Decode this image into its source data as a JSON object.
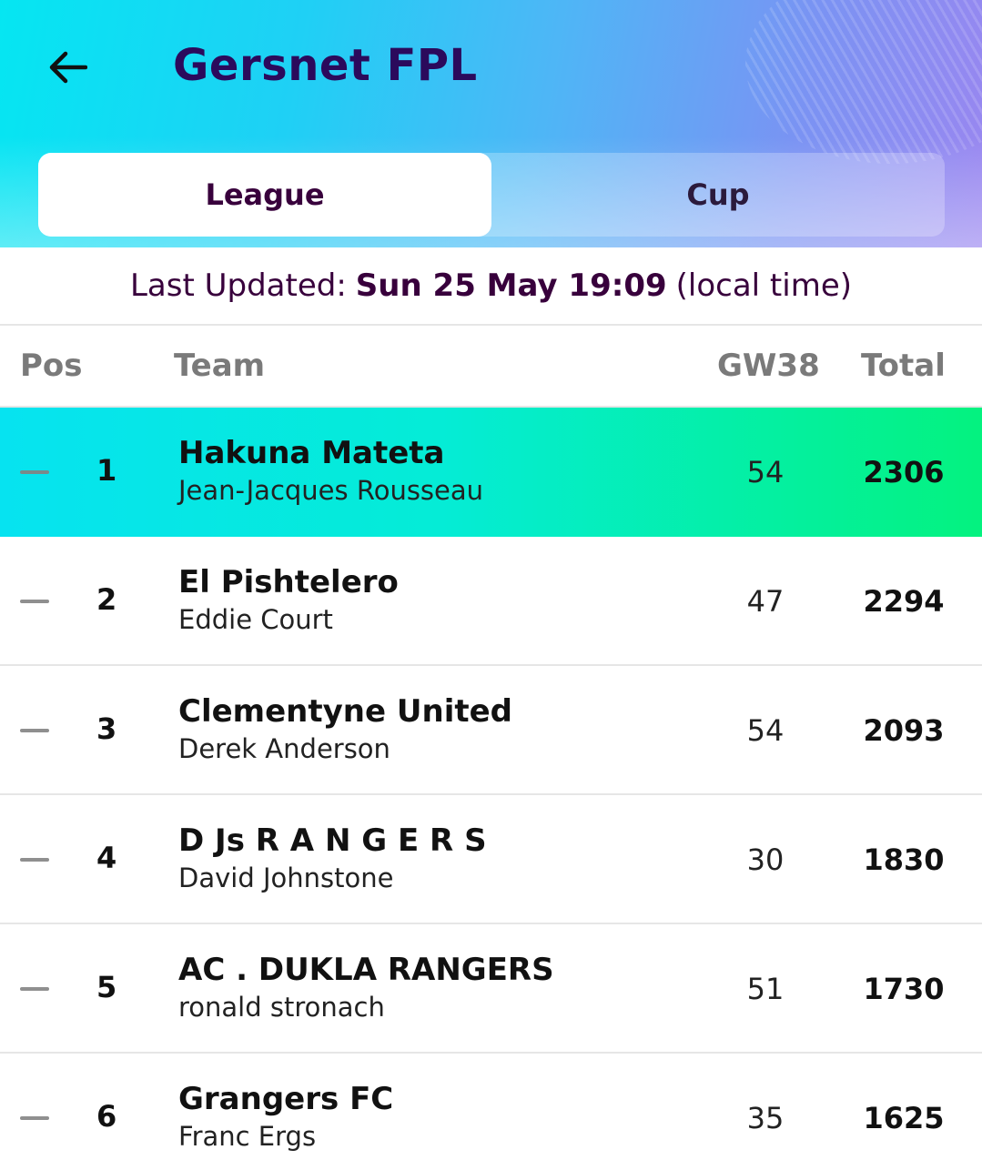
{
  "header": {
    "title": "Gersnet FPL",
    "back_icon": "arrow-left-icon"
  },
  "tabs": [
    {
      "label": "League",
      "active": true
    },
    {
      "label": "Cup",
      "active": false
    }
  ],
  "last_updated": {
    "prefix": "Last Updated:",
    "datetime": "Sun 25 May 19:09",
    "suffix": "(local time)"
  },
  "table": {
    "headers": {
      "pos": "Pos",
      "team": "Team",
      "gw": "GW38",
      "total": "Total"
    },
    "rows": [
      {
        "rank": "1",
        "team": "Hakuna Mateta",
        "manager": "Jean-Jacques Rousseau",
        "gw": "54",
        "total": "2306",
        "movement": "no-change"
      },
      {
        "rank": "2",
        "team": "El Pishtelero",
        "manager": "Eddie Court",
        "gw": "47",
        "total": "2294",
        "movement": "no-change"
      },
      {
        "rank": "3",
        "team": "Clementyne United",
        "manager": "Derek Anderson",
        "gw": "54",
        "total": "2093",
        "movement": "no-change"
      },
      {
        "rank": "4",
        "team": "D Js R A N G E R S",
        "manager": "David Johnstone",
        "gw": "30",
        "total": "1830",
        "movement": "no-change"
      },
      {
        "rank": "5",
        "team": "AC . DUKLA RANGERS",
        "manager": "ronald stronach",
        "gw": "51",
        "total": "1730",
        "movement": "no-change"
      },
      {
        "rank": "6",
        "team": "Grangers FC",
        "manager": "Franc Ergs",
        "gw": "35",
        "total": "1625",
        "movement": "no-change"
      }
    ]
  },
  "colors": {
    "brand_purple": "#38003c",
    "header_start": "#05e6f2",
    "header_end": "#9a86f0",
    "highlight_start": "#06e3f0",
    "highlight_end": "#04f27f"
  }
}
